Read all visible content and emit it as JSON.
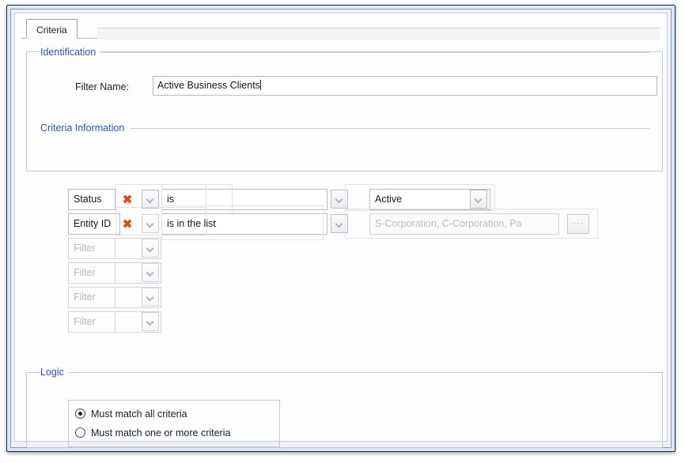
{
  "window": {
    "tab_label": "Criteria"
  },
  "identification": {
    "group_label": "Identification",
    "filter_name_label": "Filter Name:",
    "filter_name_value": "Active Business Clients"
  },
  "criteria": {
    "group_label": "Criteria Information",
    "delete_icon": "✖",
    "ellipsis_label": "···",
    "rows": [
      {
        "field": "Status",
        "operator": "is",
        "value": "Active",
        "enabled": true,
        "has_ellipsis": false
      },
      {
        "field": "Entity ID",
        "operator": "is in the list",
        "value": "S-Corporation, C-Corporation, Pa",
        "enabled": true,
        "has_ellipsis": true
      },
      {
        "field": "Filter",
        "operator": "",
        "value": "",
        "enabled": false,
        "has_ellipsis": false
      },
      {
        "field": "Filter",
        "operator": "",
        "value": "",
        "enabled": false,
        "has_ellipsis": false
      },
      {
        "field": "Filter",
        "operator": "",
        "value": "",
        "enabled": false,
        "has_ellipsis": false
      },
      {
        "field": "Filter",
        "operator": "",
        "value": "",
        "enabled": false,
        "has_ellipsis": false
      }
    ]
  },
  "logic": {
    "group_label": "Logic",
    "options": [
      {
        "label": "Must match all criteria",
        "selected": true
      },
      {
        "label": "Must match one or more criteria",
        "selected": false
      }
    ]
  },
  "colors": {
    "group_label_blue": "#2f53a0",
    "delete_red": "#e04a22",
    "window_border": "#1b2a4a"
  }
}
